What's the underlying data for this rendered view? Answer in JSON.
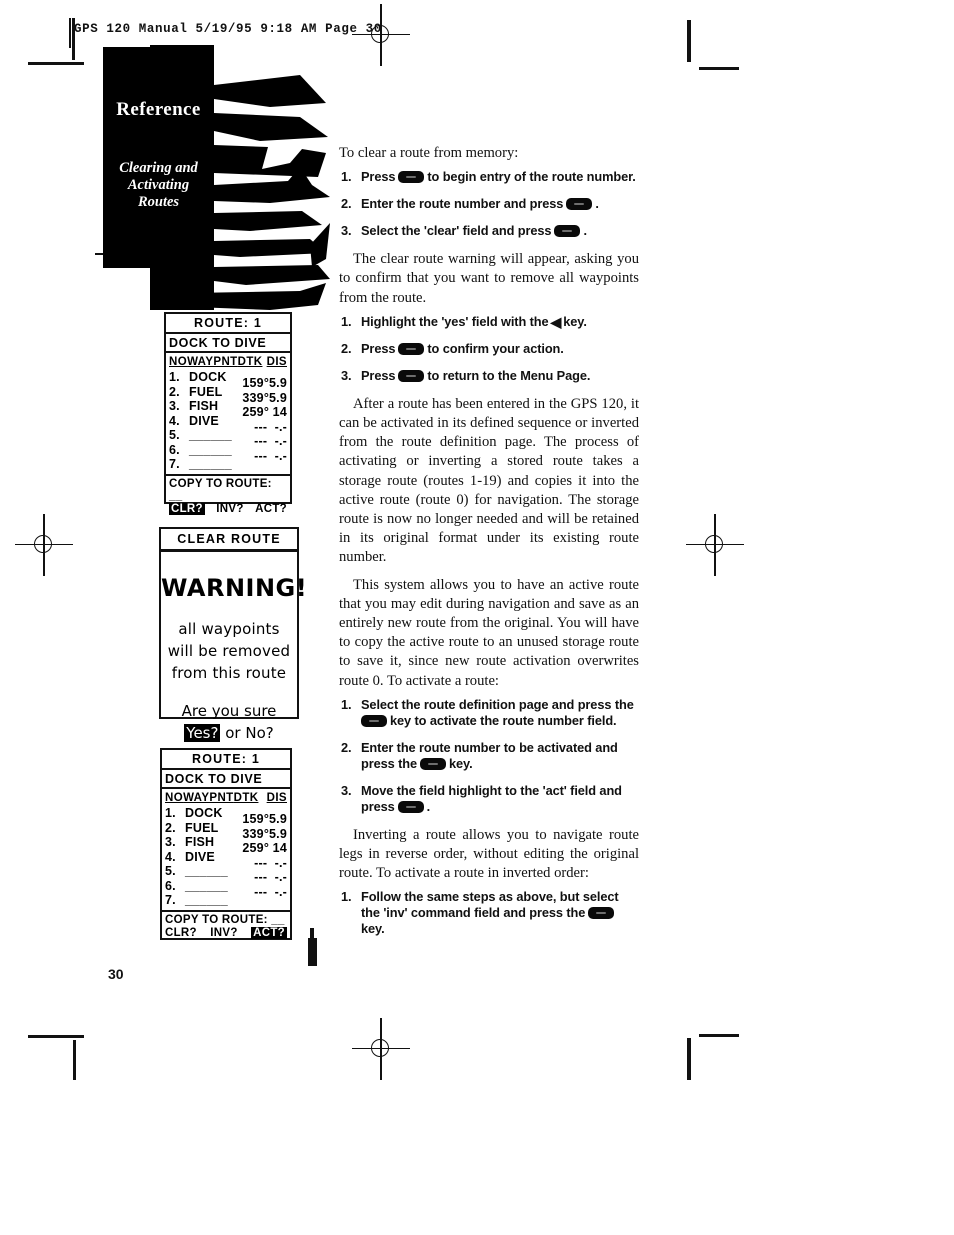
{
  "imprint": "GPS 120 Manual   5/19/95 9:18 AM   Page 30",
  "chapter": {
    "title": "Reference",
    "subtitle": "Clearing and\nActivating\nRoutes"
  },
  "page_number": "30",
  "screens": {
    "route_clear": {
      "header": "ROUTE:  1",
      "name": "DOCK TO DIVE",
      "columns": {
        "no": "NO",
        "waypoint": "WAYPNT",
        "dtk": "DTK",
        "dis": "DIS"
      },
      "rows": [
        {
          "no": "1.",
          "waypoint": "DOCK"
        },
        {
          "no": "2.",
          "waypoint": "FUEL"
        },
        {
          "no": "3.",
          "waypoint": "FISH"
        },
        {
          "no": "4.",
          "waypoint": "DIVE"
        },
        {
          "no": "5.",
          "waypoint": "______"
        },
        {
          "no": "6.",
          "waypoint": "______"
        },
        {
          "no": "7.",
          "waypoint": "______"
        }
      ],
      "legs": [
        "159°5.9",
        "339°5.9",
        "259° 14",
        "---  -.-",
        "---  -.-",
        "---  -.-"
      ],
      "copy_label": "COPY TO ROUTE: __",
      "commands": [
        {
          "label": "CLR?",
          "highlighted": true
        },
        {
          "label": "INV?",
          "highlighted": false
        },
        {
          "label": "ACT?",
          "highlighted": false
        }
      ]
    },
    "warning": {
      "header": "CLEAR ROUTE",
      "big": "WARNING!",
      "lines": [
        "all waypoints",
        "will be removed",
        "from this route"
      ],
      "question": "Are you sure",
      "yes": "Yes?",
      "or": " or ",
      "no": "No?"
    },
    "route_act": {
      "header": "ROUTE:  1",
      "name": "DOCK TO DIVE",
      "columns": {
        "no": "NO",
        "waypoint": "WAYPNT",
        "dtk": "DTK",
        "dis": "DIS"
      },
      "rows": [
        {
          "no": "1.",
          "waypoint": "DOCK"
        },
        {
          "no": "2.",
          "waypoint": "FUEL"
        },
        {
          "no": "3.",
          "waypoint": "FISH"
        },
        {
          "no": "4.",
          "waypoint": "DIVE"
        },
        {
          "no": "5.",
          "waypoint": "______"
        },
        {
          "no": "6.",
          "waypoint": "______"
        },
        {
          "no": "7.",
          "waypoint": "______"
        }
      ],
      "legs": [
        "159°5.9",
        "339°5.9",
        "259° 14",
        "---  -.-",
        "---  -.-",
        "---  -.-"
      ],
      "copy_label": "COPY TO ROUTE: __",
      "commands": [
        {
          "label": "CLR?",
          "highlighted": false
        },
        {
          "label": "INV?",
          "highlighted": false
        },
        {
          "label": "ACT?",
          "highlighted": true
        }
      ]
    }
  },
  "body": {
    "lead_clear": "To clear a route from memory:",
    "steps_clear": [
      {
        "num": "1.",
        "pre": "Press",
        "post": "to begin entry of the route number."
      },
      {
        "num": "2.",
        "pre": "Enter the route number and press",
        "post": "."
      },
      {
        "num": "3.",
        "pre": "Select the 'clear' field and press",
        "post": "."
      }
    ],
    "para_warning": "The clear route warning will appear, asking you to confirm that you want to remove all waypoints from the route.",
    "steps_confirm": [
      {
        "num": "1.",
        "pre": "Highlight the 'yes' field with the",
        "post": "key."
      },
      {
        "num": "2.",
        "pre": "Press",
        "post": "to confirm your action."
      },
      {
        "num": "3.",
        "pre": "Press",
        "post": "to return to the Menu Page."
      }
    ],
    "para_after": "After a route has been entered in the GPS 120, it can be activated in its defined sequence or inverted from the route definition page. The process of activating or inverting a stored route takes a storage route (routes 1-19) and copies it into the active route (route 0) for navigation. The storage route is now no longer needed and will be retained in its original format under its existing route number.",
    "para_system": "This system allows you to have an active route that you may edit during navigation and save as an entirely new route from the original. You will have to copy the active route to an unused storage route to save it, since new route activation overwrites route 0. To activate a route:",
    "steps_activate": [
      {
        "num": "1.",
        "pre": "Select the route definition page and press the",
        "post": "key to activate the route number field."
      },
      {
        "num": "2.",
        "pre": "Enter the route number to be activated and press the",
        "post": "key."
      },
      {
        "num": "3.",
        "pre": "Move the field highlight to the 'act' field and press",
        "post": "."
      }
    ],
    "para_invert": "Inverting a route allows you to navigate route legs in reverse order, without editing the original route. To activate a route in inverted order:",
    "steps_invert": [
      {
        "num": "1.",
        "pre": "Follow the same steps as above, but select the 'inv' command field and press the",
        "post": "key."
      }
    ]
  }
}
